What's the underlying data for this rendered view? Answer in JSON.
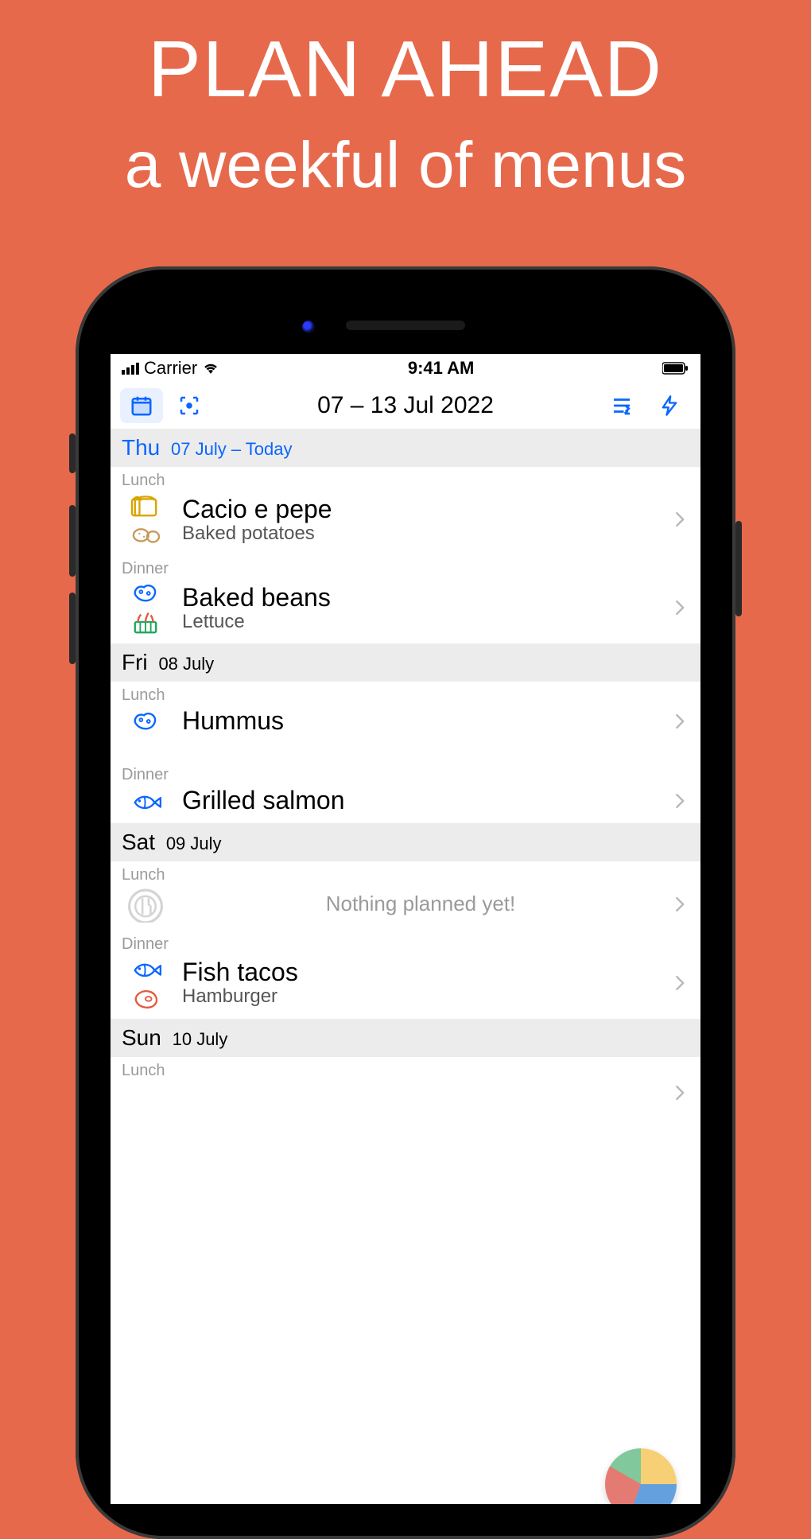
{
  "promo": {
    "headline": "PLAN AHEAD",
    "subline": "a weekful of menus"
  },
  "status": {
    "carrier": "Carrier",
    "time": "9:41 AM"
  },
  "toolbar": {
    "date_range": "07 – 13 Jul 2022"
  },
  "labels": {
    "lunch": "Lunch",
    "dinner": "Dinner",
    "nothing": "Nothing planned yet!"
  },
  "days": [
    {
      "key": "thu",
      "weekday": "Thu",
      "date": "07 July – Today",
      "today": true,
      "lunch": {
        "main": "Cacio e pepe",
        "sub": "Baked potatoes",
        "icons": [
          "bread",
          "potato"
        ]
      },
      "dinner": {
        "main": "Baked beans",
        "sub": "Lettuce",
        "icons": [
          "beans",
          "veggies"
        ]
      }
    },
    {
      "key": "fri",
      "weekday": "Fri",
      "date": "08 July",
      "today": false,
      "lunch": {
        "main": "Hummus",
        "sub": "",
        "icons": [
          "beans"
        ]
      },
      "dinner": {
        "main": "Grilled salmon",
        "sub": "",
        "icons": [
          "fish"
        ]
      }
    },
    {
      "key": "sat",
      "weekday": "Sat",
      "date": "09 July",
      "today": false,
      "lunch": {
        "empty": true,
        "icons": [
          "plate-empty"
        ]
      },
      "dinner": {
        "main": "Fish tacos",
        "sub": "Hamburger",
        "icons": [
          "fish",
          "meat"
        ]
      }
    },
    {
      "key": "sun",
      "weekday": "Sun",
      "date": "10 July",
      "today": false,
      "lunch": {
        "main": "",
        "sub": "",
        "icons": []
      }
    }
  ]
}
